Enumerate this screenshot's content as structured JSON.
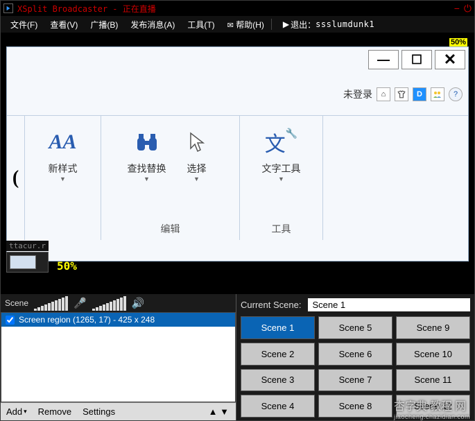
{
  "title": {
    "app": "XSplit Broadcaster",
    "status": "正在直播"
  },
  "menu": {
    "file": "文件(F)",
    "view": "查看(V)",
    "broadcast": "广播(B)",
    "record": "发布消息(A)",
    "tools": "工具(T)",
    "help": "帮助(H)",
    "logout_label": "退出：",
    "logout_user": "ssslumdunk1"
  },
  "preview": {
    "zoom_badge": "50%",
    "login_status": "未登录",
    "deco_text": "ttacur.r",
    "deco_pct": "50%",
    "header_icons": {
      "d": "D",
      "help": "?"
    },
    "ribbon": {
      "newstyle": "新样式",
      "findreplace": "查找替换",
      "select": "选择",
      "texttool": "文字工具",
      "group_edit": "编辑",
      "group_tool": "工具",
      "aa": "AA"
    }
  },
  "panel": {
    "scene_label": "Scene",
    "source_text": "Screen region (1265, 17) - 425 x 248",
    "add": "Add",
    "remove": "Remove",
    "settings": "Settings",
    "current_scene_label": "Current Scene:",
    "current_scene": "Scene 1",
    "scenes_grid": [
      "Scene 1",
      "Scene 5",
      "Scene 9",
      "Scene 2",
      "Scene 6",
      "Scene 10",
      "Scene 3",
      "Scene 7",
      "Scene 11",
      "Scene 4",
      "Scene 8",
      "Scene 12"
    ],
    "active_index": 0
  },
  "watermark": {
    "main": "杏字典 教程 网",
    "sub": "jiaocheng.chazidian.com"
  }
}
